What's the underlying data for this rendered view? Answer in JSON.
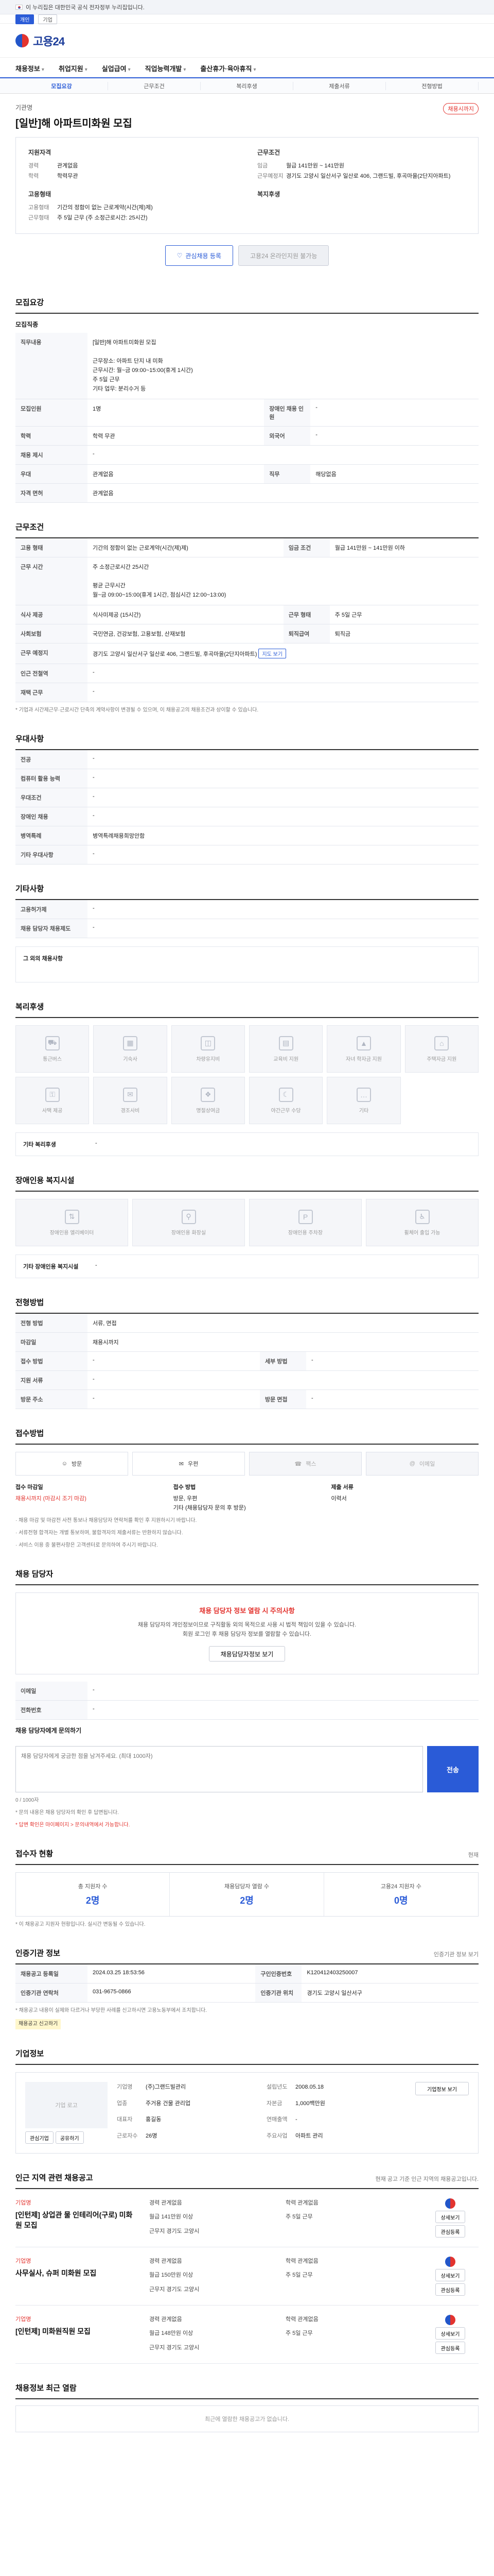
{
  "gov_banner": {
    "text": "이 누리집은 대한민국 공식 전자정부 누리집입니다."
  },
  "sub_strip": {
    "items": [
      "개인",
      "기업"
    ]
  },
  "brand": {
    "name": "고용24"
  },
  "gnb": {
    "items": [
      "채용정보",
      "취업지원",
      "실업급여",
      "직업능력개발",
      "출산휴가·육아휴직"
    ]
  },
  "lnb": {
    "tabs": [
      "모집요강",
      "근무조건",
      "복리후생",
      "제출서류",
      "전형방법"
    ]
  },
  "job": {
    "company": "기관명",
    "title": "[일반]해 아파트미화원 모집",
    "badge": "채용시까지",
    "summary": {
      "left_title": "지원자격",
      "left_rows": [
        {
          "k": "경력",
          "v": "관계없음"
        },
        {
          "k": "학력",
          "v": "학력무관"
        }
      ],
      "left2_title": "고용형태",
      "left2_rows": [
        {
          "k": "고용형태",
          "v": "기간의 정함이 없는 근로계약(시간(제)제)"
        },
        {
          "k": "근무형태",
          "v": "주 5일 근무 (주 소정근로시간: 25시간)"
        }
      ],
      "right_title": "근무조건",
      "right_rows": [
        {
          "k": "임금",
          "v": "월급 141만원 ~ 141만원"
        },
        {
          "k": "근무예정지",
          "v": "경기도 고양시 일산서구 일산로 406, 그랜드빌, 후곡마을(2단지아파트)"
        }
      ],
      "right2_title": "복지후생",
      "right2_rows": [
        {
          "k": "",
          "v": ""
        }
      ]
    },
    "buttons": {
      "save": "관심채용 등록",
      "apply": "고용24 온라인지원 불가능"
    }
  },
  "recruit": {
    "title": "모집요강",
    "sub": "모집직종",
    "rows": [
      {
        "k": "직무내용",
        "v": "[일반]해 아파트미화원 모집\n\n근무장소: 아파트 단지 내 미화\n근무시간: 월~금 09:00~15:00(휴게 1시간)\n주 5일 근무\n기타 업무: 분리수거 등"
      },
      {
        "k": "모집인원",
        "v": "1명"
      },
      {
        "k": "경력조건",
        "v": "관계없음"
      },
      {
        "k": "학력",
        "v": "학력무관"
      },
      {
        "k": "전공",
        "v": "관계없음"
      },
      {
        "k": "자격 면허",
        "v": "관계없음"
      }
    ],
    "kv2": [
      {
        "k": "모집인원",
        "v": "1명",
        "k2": "장애인 채용 인원",
        "v2": "-"
      },
      {
        "k": "학력",
        "v": "학력 무관",
        "k2": "외국어",
        "v2": "-"
      },
      {
        "k": "채용 제시",
        "v": "-",
        "k2": "",
        "v2": ""
      },
      {
        "k": "우대",
        "v": "관계없음",
        "k2": "직무",
        "v2": "해당없음"
      },
      {
        "k": "자격 면허",
        "v": "관계없음",
        "k2": "",
        "v2": ""
      }
    ]
  },
  "conditions": {
    "title": "근무조건",
    "rows": [
      {
        "k": "고용 형태",
        "v": "기간의 정함이 없는 근로계약(시간(제)제)",
        "k2": "임금 조건",
        "v2": "월급 141만원 ~ 141만원 이하"
      },
      {
        "k": "근무 시간",
        "v": "주 소정근로시간 25시간\n\n평균 근무시간\n월~금 09:00~15:00(휴게 1시간, 점심시간 12:00~13:00)",
        "k2": "",
        "v2": ""
      },
      {
        "k": "식사 제공",
        "v": "식사미제공 (15시간)",
        "k2": "근무 형태",
        "v2": "주 5일 근무"
      },
      {
        "k": "사회보험",
        "v": "국민연금, 건강보험, 고용보험, 산재보험",
        "k2": "퇴직급여",
        "v2": "퇴직금"
      },
      {
        "k": "근무 예정지",
        "v": "경기도 고양시 일산서구 일산로 406, 그랜드빌, 후곡마을(2단지아파트)",
        "k2": "",
        "v2": ""
      },
      {
        "k": "인근 전철역",
        "v": "-",
        "k2": "",
        "v2": ""
      },
      {
        "k": "재택 근무",
        "v": "-",
        "k2": "",
        "v2": ""
      }
    ],
    "map_btn": "지도 보기",
    "note": "* 기업과 시간제근무·근로시간 단축의 계약사항이 변경될 수 있으며, 이 채용공고의 채용조건과 상이할 수 있습니다."
  },
  "preference": {
    "title": "우대사항",
    "rows": [
      {
        "k": "전공",
        "v": "-"
      },
      {
        "k": "컴퓨터 활용 능력",
        "v": "-"
      },
      {
        "k": "우대조건",
        "v": "-"
      },
      {
        "k": "장애인 채용",
        "v": "-"
      },
      {
        "k": "병역특례",
        "v": "병역특례채용희망안함"
      },
      {
        "k": "기타 우대사항",
        "v": "-"
      }
    ]
  },
  "other": {
    "title": "기타사항",
    "rows": [
      {
        "k": "고용허가제",
        "v": "-"
      },
      {
        "k": "채용 담당자 채용제도",
        "v": "-"
      }
    ],
    "extra_label": "그 외의 채용사항"
  },
  "welfare": {
    "title": "복리후생",
    "items": [
      "통근버스",
      "기숙사",
      "차량유지비",
      "교육비 지원",
      "자녀 학자금 지원",
      "주택자금 지원",
      "사택 제공",
      "경조사비",
      "명절상여금",
      "야간근무 수당",
      "기타"
    ],
    "other_label": "기타 복리후생",
    "other_value": "-"
  },
  "disability": {
    "title": "장애인용 복지시설",
    "items": [
      "장애인용 엘리베이터",
      "장애인용 화장실",
      "장애인용 주차장",
      "휠체어 출입 가능"
    ],
    "other_label": "기타 장애인용 복지시설",
    "other_value": "-"
  },
  "screening": {
    "title": "전형방법",
    "rows": [
      {
        "k": "전형 방법",
        "v": "서류, 면접",
        "k2": "",
        "v2": ""
      },
      {
        "k": "마감일",
        "v": "채용시까지",
        "k2": "",
        "v2": ""
      },
      {
        "k": "접수 방법",
        "v": "-",
        "k2": "세부 방법",
        "v2": "-"
      },
      {
        "k": "지원 서류",
        "v": "-",
        "k2": "",
        "v2": ""
      },
      {
        "k": "방문 주소",
        "v": "-",
        "k2": "방문 면접",
        "v2": "-"
      }
    ]
  },
  "apply_method": {
    "title": "접수방법",
    "methods": [
      {
        "label": "방문",
        "on": true
      },
      {
        "label": "우편",
        "on": true
      },
      {
        "label": "팩스",
        "on": false
      },
      {
        "label": "이메일",
        "on": false
      }
    ],
    "docs": [
      {
        "title": "접수 마감일",
        "value": "채용시까지 (마감시 조기 마감)"
      },
      {
        "title": "접수 방법",
        "value": "방문, 우편\n기타 (채용담당자 문의 후 방문)"
      },
      {
        "title": "제출 서류",
        "value": "이력서"
      }
    ],
    "notes": [
      "· 채용 마감 및 마감전 사전 통보나 채용담당자 연락처를 확인 후 지원하시기 바랍니다.",
      "· 서류전형 합격자는 개별 통보하며, 불합격자의 제출서류는 반환하지 않습니다.",
      "· 서비스 이용 중 불편사항은 고객센터로 문의하여 주시기 바랍니다."
    ]
  },
  "contact": {
    "title": "채용 담당자",
    "warn": "채용 담당자 정보 열람 시 주의사항",
    "text": "채용 담당자의 개인정보이므로 구직활동 외의 목적으로 사용 시 법적 책임이 있을 수 있습니다.\n회원 로그인 후 채용 담당자 정보를 열람할 수 있습니다.",
    "btn": "채용담당자정보 보기",
    "rows": [
      {
        "k": "이메일",
        "v": "-"
      },
      {
        "k": "전화번호",
        "v": "-"
      }
    ],
    "inquiry_title": "채용 담당자에게 문의하기",
    "inquiry_placeholder": "채용 담당자에게 궁금한 점을 남겨주세요. (최대 1000자)",
    "inquiry_count": "0 / 1000자",
    "send": "전송",
    "inquiry_notes": [
      "* 문의 내용은 채용 담당자의 확인 후 답변됩니다.",
      "* 답변 확인은 마이페이지 > 문의내역에서 가능합니다."
    ]
  },
  "status": {
    "title": "접수자 현황",
    "aside": "현재",
    "stats": [
      {
        "label": "총 지원자 수",
        "value": "2명"
      },
      {
        "label": "채용담당자 열람 수",
        "value": "2명"
      },
      {
        "label": "고용24 지원자 수",
        "value": "0명"
      }
    ],
    "note": "* 이 채용공고 지원자 현황입니다. 실시간 변동될 수 있습니다."
  },
  "agency": {
    "title": "인증기관 정보",
    "btn": "인증기관 정보 보기",
    "rows": [
      {
        "k": "채용공고 등록일",
        "v": "2024.03.25 18:53:56",
        "k2": "구인인증번호",
        "v2": "K120412403250007"
      },
      {
        "k": "인증기관 연락처",
        "v": "031-9675-0866",
        "k2": "인증기관 위치",
        "v2": "경기도 고양시 일산서구"
      }
    ],
    "note": "* 채용공고 내용이 실제와 다르거나 부당한 사례를 신고하시면 고용노동부에서 조치합니다.",
    "report": "채용공고 신고하기"
  },
  "company": {
    "title": "기업정보",
    "logo_alt": "기업 로고",
    "rows": [
      {
        "k": "기업명",
        "v": "(주)그랜드빌관리"
      },
      {
        "k": "업종",
        "v": "주거용 건물 관리업"
      },
      {
        "k": "대표자",
        "v": "홍길동"
      },
      {
        "k": "근로자수",
        "v": "26명"
      },
      {
        "k": "설립년도",
        "v": "2008.05.18"
      },
      {
        "k": "자본금",
        "v": "1,000백만원"
      },
      {
        "k": "연매출액",
        "v": "-"
      },
      {
        "k": "주요사업",
        "v": "아파트 관리"
      }
    ],
    "btn_follow": "관심기업",
    "btn_share": "공유하기",
    "btn_more": "기업정보 보기"
  },
  "related": {
    "title": "인근 지역 관련 채용공고",
    "aside": "현재 공고 기준 인근 지역의 채용공고입니다.",
    "items": [
      {
        "company": "기업명",
        "title": "[인턴제] 상업관 물 인테리어(구로) 미화원 모집",
        "rows": [
          "경력 관계없음",
          "학력 관계없음",
          "월급 141만원 이상",
          "주 5일 근무",
          "근무지 경기도 고양시"
        ]
      },
      {
        "company": "기업명",
        "title": "사무실사, 슈퍼 미화원 모집",
        "rows": [
          "경력 관계없음",
          "학력 관계없음",
          "월급 150만원 이상",
          "주 5일 근무",
          "근무지 경기도 고양시"
        ]
      },
      {
        "company": "기업명",
        "title": "[인턴제] 미화원직원 모집",
        "rows": [
          "경력 관계없음",
          "학력 관계없음",
          "월급 148만원 이상",
          "주 5일 근무",
          "근무지 경기도 고양시"
        ]
      }
    ],
    "btn_view": "상세보기",
    "btn_save": "관심등록"
  },
  "recent": {
    "title": "채용정보 최근 열람",
    "empty": "최근에 열람한 채용공고가 없습니다."
  }
}
